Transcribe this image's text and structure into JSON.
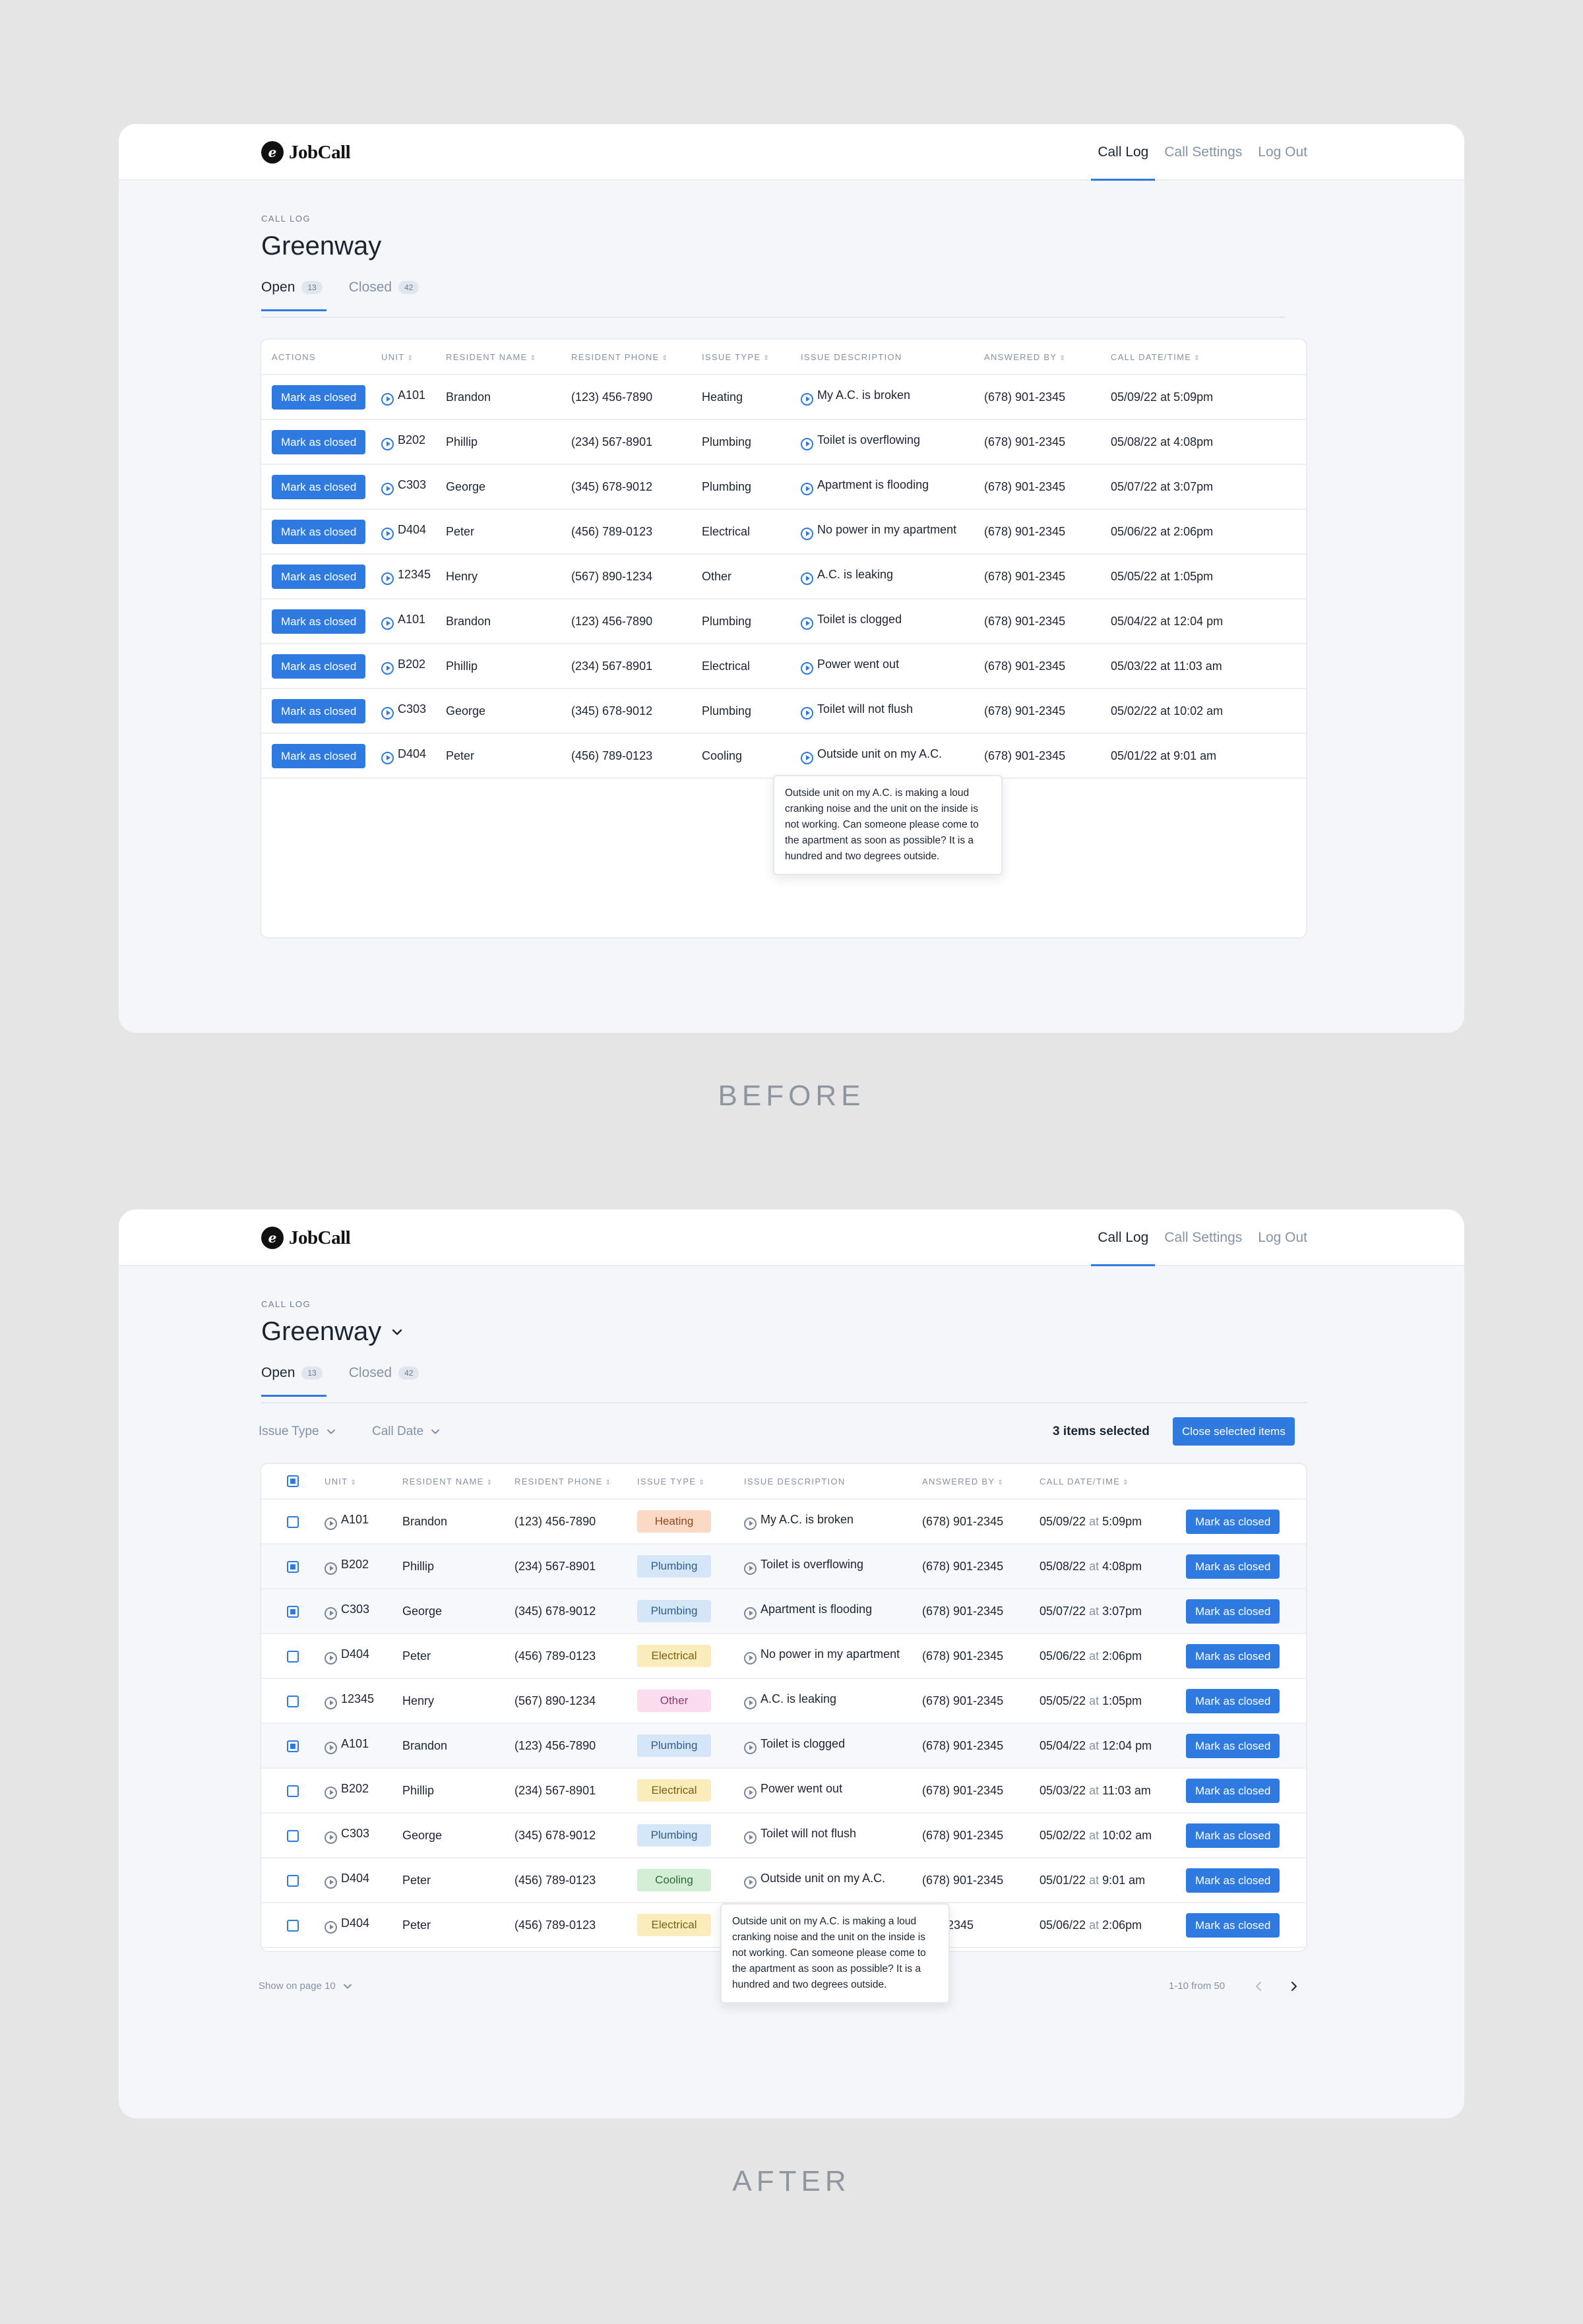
{
  "app": {
    "name": "JobCall",
    "logo_glyph": "ℯ"
  },
  "nav": {
    "items": [
      "Call Log",
      "Call Settings",
      "Log Out"
    ],
    "active": "Call Log"
  },
  "page": {
    "overline": "CALL LOG",
    "title": "Greenway"
  },
  "tabs": [
    {
      "label": "Open",
      "count": "13"
    },
    {
      "label": "Closed",
      "count": "42"
    }
  ],
  "before": {
    "columns": [
      "ACTIONS",
      "UNIT",
      "RESIDENT NAME",
      "RESIDENT PHONE",
      "ISSUE TYPE",
      "ISSUE DESCRIPTION",
      "ANSWERED BY",
      "CALL DATE/TIME"
    ],
    "rows": [
      {
        "action": "Mark as closed",
        "unit": "A101",
        "name": "Brandon",
        "phone": "(123) 456-7890",
        "type": "Heating",
        "desc": "My A.C. is broken",
        "answered": "(678) 901-2345",
        "datetime": "05/09/22 at 5:09pm"
      },
      {
        "action": "Mark as closed",
        "unit": "B202",
        "name": "Phillip",
        "phone": "(234) 567-8901",
        "type": "Plumbing",
        "desc": "Toilet is overflowing",
        "answered": "(678) 901-2345",
        "datetime": "05/08/22 at 4:08pm"
      },
      {
        "action": "Mark as closed",
        "unit": "C303",
        "name": "George",
        "phone": "(345) 678-9012",
        "type": "Plumbing",
        "desc": "Apartment is flooding",
        "answered": "(678) 901-2345",
        "datetime": "05/07/22 at 3:07pm"
      },
      {
        "action": "Mark as closed",
        "unit": "D404",
        "name": "Peter",
        "phone": "(456) 789-0123",
        "type": "Electrical",
        "desc": "No power in my apartment",
        "answered": "(678) 901-2345",
        "datetime": "05/06/22 at 2:06pm"
      },
      {
        "action": "Mark as closed",
        "unit": "12345",
        "name": "Henry",
        "phone": "(567) 890-1234",
        "type": "Other",
        "desc": "A.C. is leaking",
        "answered": "(678) 901-2345",
        "datetime": "05/05/22 at 1:05pm"
      },
      {
        "action": "Mark as closed",
        "unit": "A101",
        "name": "Brandon",
        "phone": "(123) 456-7890",
        "type": "Plumbing",
        "desc": "Toilet is clogged",
        "answered": "(678) 901-2345",
        "datetime": "05/04/22 at 12:04 pm"
      },
      {
        "action": "Mark as closed",
        "unit": "B202",
        "name": "Phillip",
        "phone": "(234) 567-8901",
        "type": "Electrical",
        "desc": "Power went out",
        "answered": "(678) 901-2345",
        "datetime": "05/03/22 at 11:03 am"
      },
      {
        "action": "Mark as closed",
        "unit": "C303",
        "name": "George",
        "phone": "(345) 678-9012",
        "type": "Plumbing",
        "desc": "Toilet will not flush",
        "answered": "(678) 901-2345",
        "datetime": "05/02/22 at 10:02 am"
      },
      {
        "action": "Mark as closed",
        "unit": "D404",
        "name": "Peter",
        "phone": "(456) 789-0123",
        "type": "Cooling",
        "desc": "Outside unit on my A.C.",
        "answered": "(678) 901-2345",
        "datetime": "05/01/22 at 9:01 am"
      }
    ],
    "tooltip": "Outside unit on my A.C. is making a loud cranking noise and the unit on the inside is not working. Can someone please come to the apartment as soon as possible? It is a hundred and two degrees outside.",
    "caption": "BEFORE"
  },
  "after": {
    "filters": [
      "Issue Type",
      "Call Date"
    ],
    "selected_count": "3 items selected",
    "close_selected": "Close selected items",
    "columns": [
      "",
      "UNIT",
      "RESIDENT NAME",
      "RESIDENT PHONE",
      "ISSUE TYPE",
      "ISSUE DESCRIPTION",
      "ANSWERED BY",
      "CALL DATE/TIME",
      ""
    ],
    "rows": [
      {
        "checked": false,
        "unit": "A101",
        "name": "Brandon",
        "phone": "(123) 456-7890",
        "type": "Heating",
        "desc": "My A.C. is broken",
        "answered": "(678) 901-2345",
        "date": "05/09/22",
        "at": "at",
        "time": "5:09pm",
        "action": "Mark as closed"
      },
      {
        "checked": true,
        "unit": "B202",
        "name": "Phillip",
        "phone": "(234) 567-8901",
        "type": "Plumbing",
        "desc": "Toilet is overflowing",
        "answered": "(678) 901-2345",
        "date": "05/08/22",
        "at": "at",
        "time": "4:08pm",
        "action": "Mark as closed"
      },
      {
        "checked": true,
        "unit": "C303",
        "name": "George",
        "phone": "(345) 678-9012",
        "type": "Plumbing",
        "desc": "Apartment is flooding",
        "answered": "(678) 901-2345",
        "date": "05/07/22",
        "at": "at",
        "time": "3:07pm",
        "action": "Mark as closed"
      },
      {
        "checked": false,
        "unit": "D404",
        "name": "Peter",
        "phone": "(456) 789-0123",
        "type": "Electrical",
        "desc": "No power in my apartment",
        "answered": "(678) 901-2345",
        "date": "05/06/22",
        "at": "at",
        "time": "2:06pm",
        "action": "Mark as closed"
      },
      {
        "checked": false,
        "unit": "12345",
        "name": "Henry",
        "phone": "(567) 890-1234",
        "type": "Other",
        "desc": "A.C. is leaking",
        "answered": "(678) 901-2345",
        "date": "05/05/22",
        "at": "at",
        "time": "1:05pm",
        "action": "Mark as closed"
      },
      {
        "checked": true,
        "unit": "A101",
        "name": "Brandon",
        "phone": "(123) 456-7890",
        "type": "Plumbing",
        "desc": "Toilet is clogged",
        "answered": "(678) 901-2345",
        "date": "05/04/22",
        "at": "at",
        "time": "12:04 pm",
        "action": "Mark as closed"
      },
      {
        "checked": false,
        "unit": "B202",
        "name": "Phillip",
        "phone": "(234) 567-8901",
        "type": "Electrical",
        "desc": "Power went out",
        "answered": "(678) 901-2345",
        "date": "05/03/22",
        "at": "at",
        "time": "11:03 am",
        "action": "Mark as closed"
      },
      {
        "checked": false,
        "unit": "C303",
        "name": "George",
        "phone": "(345) 678-9012",
        "type": "Plumbing",
        "desc": "Toilet will not flush",
        "answered": "(678) 901-2345",
        "date": "05/02/22",
        "at": "at",
        "time": "10:02 am",
        "action": "Mark as closed"
      },
      {
        "checked": false,
        "unit": "D404",
        "name": "Peter",
        "phone": "(456) 789-0123",
        "type": "Cooling",
        "desc": "Outside unit on my A.C.",
        "answered": "(678) 901-2345",
        "date": "05/01/22",
        "at": "at",
        "time": "9:01 am",
        "action": "Mark as closed"
      },
      {
        "checked": false,
        "unit": "D404",
        "name": "Peter",
        "phone": "(456) 789-0123",
        "type": "Electrical",
        "desc": "",
        "answered": "901-2345",
        "date": "05/06/22",
        "at": "at",
        "time": "2:06pm",
        "action": "Mark as closed"
      }
    ],
    "tooltip": "Outside unit on my A.C. is making a loud cranking noise and the unit on the inside is not working. Can someone please come to the apartment as soon as possible? It is a hundred and two degrees outside.",
    "footer": {
      "page_size_label": "Show on page 10",
      "range": "1-10 from 50"
    },
    "caption": "AFTER"
  },
  "pill_colors": {
    "Heating": {
      "bg": "#fbd9c4",
      "fg": "#8a4a26"
    },
    "Plumbing": {
      "bg": "#d5e6f8",
      "fg": "#2f5f8f"
    },
    "Electrical": {
      "bg": "#fbecbc",
      "fg": "#7a6013"
    },
    "Other": {
      "bg": "#fbdcef",
      "fg": "#874070"
    },
    "Cooling": {
      "bg": "#d2efd6",
      "fg": "#2e6b39"
    }
  },
  "colors": {
    "accent": "#2e7ae0",
    "text": "#1c2434",
    "muted": "#8592a6",
    "background": "#e5e5e5",
    "panel": "#f4f6f9"
  }
}
